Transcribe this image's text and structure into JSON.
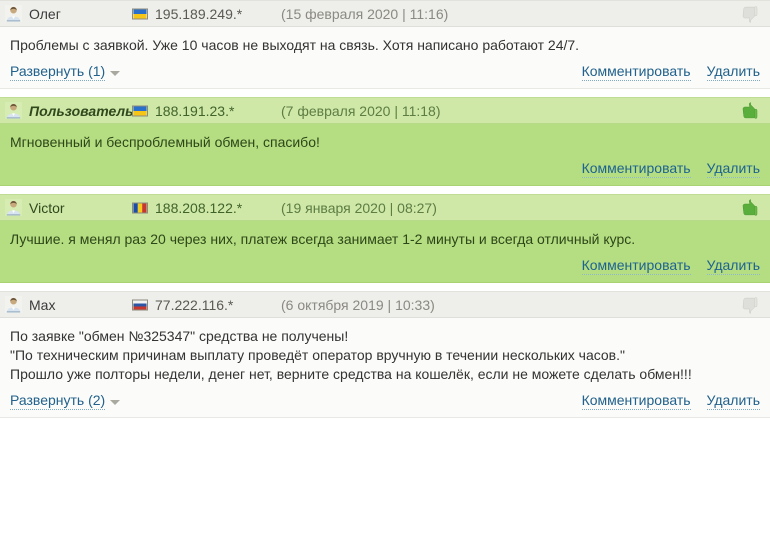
{
  "colors": {
    "neutral_header_bg": "#eeeeea",
    "neutral_body_bg": "#fbfbf9",
    "positive_header_bg": "#cfe8a8",
    "positive_body_bg": "#b5dd82",
    "link": "#21618c",
    "thumb_up": "#55a83a",
    "thumb_down": "#d6d6d0"
  },
  "labels": {
    "comment": "Комментировать",
    "delete": "Удалить"
  },
  "icons": {
    "avatar": "user-avatar-icon",
    "thumb_up": "thumbs-up-icon",
    "thumb_down": "thumbs-down-icon",
    "caret": "chevron-down-icon"
  },
  "comments": [
    {
      "id": "comment-1",
      "tone": "neutral",
      "username": "Олег",
      "username_italic": false,
      "country": "Ukraine",
      "flag": "ua-flag-icon",
      "ip": "195.189.249.*",
      "date": "(15 февраля 2020 | 11:16)",
      "rating_icon": "thumbs-down-icon",
      "text": "Проблемы с заявкой. Уже 10 часов не выходят на связь. Хотя написано работают 24/7.",
      "expand_label": "Развернуть (1)",
      "has_expand": true,
      "comment_label": "Комментировать",
      "delete_label": "Удалить"
    },
    {
      "id": "comment-2",
      "tone": "positive",
      "username": "Пользователь",
      "username_italic": true,
      "country": "Ukraine",
      "flag": "ua-flag-icon",
      "ip": "188.191.23.*",
      "date": "(7 февраля 2020 | 11:18)",
      "rating_icon": "thumbs-up-icon",
      "text": "Мгновенный и беспроблемный обмен, спасибо!",
      "expand_label": "",
      "has_expand": false,
      "comment_label": "Комментировать",
      "delete_label": "Удалить"
    },
    {
      "id": "comment-3",
      "tone": "positive",
      "username": "Victor",
      "username_italic": false,
      "country": "Moldova",
      "flag": "md-flag-icon",
      "ip": "188.208.122.*",
      "date": "(19 января 2020 | 08:27)",
      "rating_icon": "thumbs-up-icon",
      "text": "Лучшие. я менял раз 20 через них, платеж всегда занимает 1-2 минуты и всегда отличный курс.",
      "expand_label": "",
      "has_expand": false,
      "comment_label": "Комментировать",
      "delete_label": "Удалить"
    },
    {
      "id": "comment-4",
      "tone": "neutral",
      "username": "Max",
      "username_italic": false,
      "country": "Russia",
      "flag": "ru-flag-icon",
      "ip": "77.222.116.*",
      "date": "(6 октября 2019 | 10:33)",
      "rating_icon": "thumbs-down-icon",
      "text": "По заявке \"обмен №325347\" средства не получены!\n\"По техническим причинам выплату проведёт оператор вручную в течении нескольких часов.\"\nПрошло уже полторы недели, денег нет, верните средства на кошелёк, если не можете сделать обмен!!!",
      "expand_label": "Развернуть (2)",
      "has_expand": true,
      "comment_label": "Комментировать",
      "delete_label": "Удалить"
    }
  ]
}
